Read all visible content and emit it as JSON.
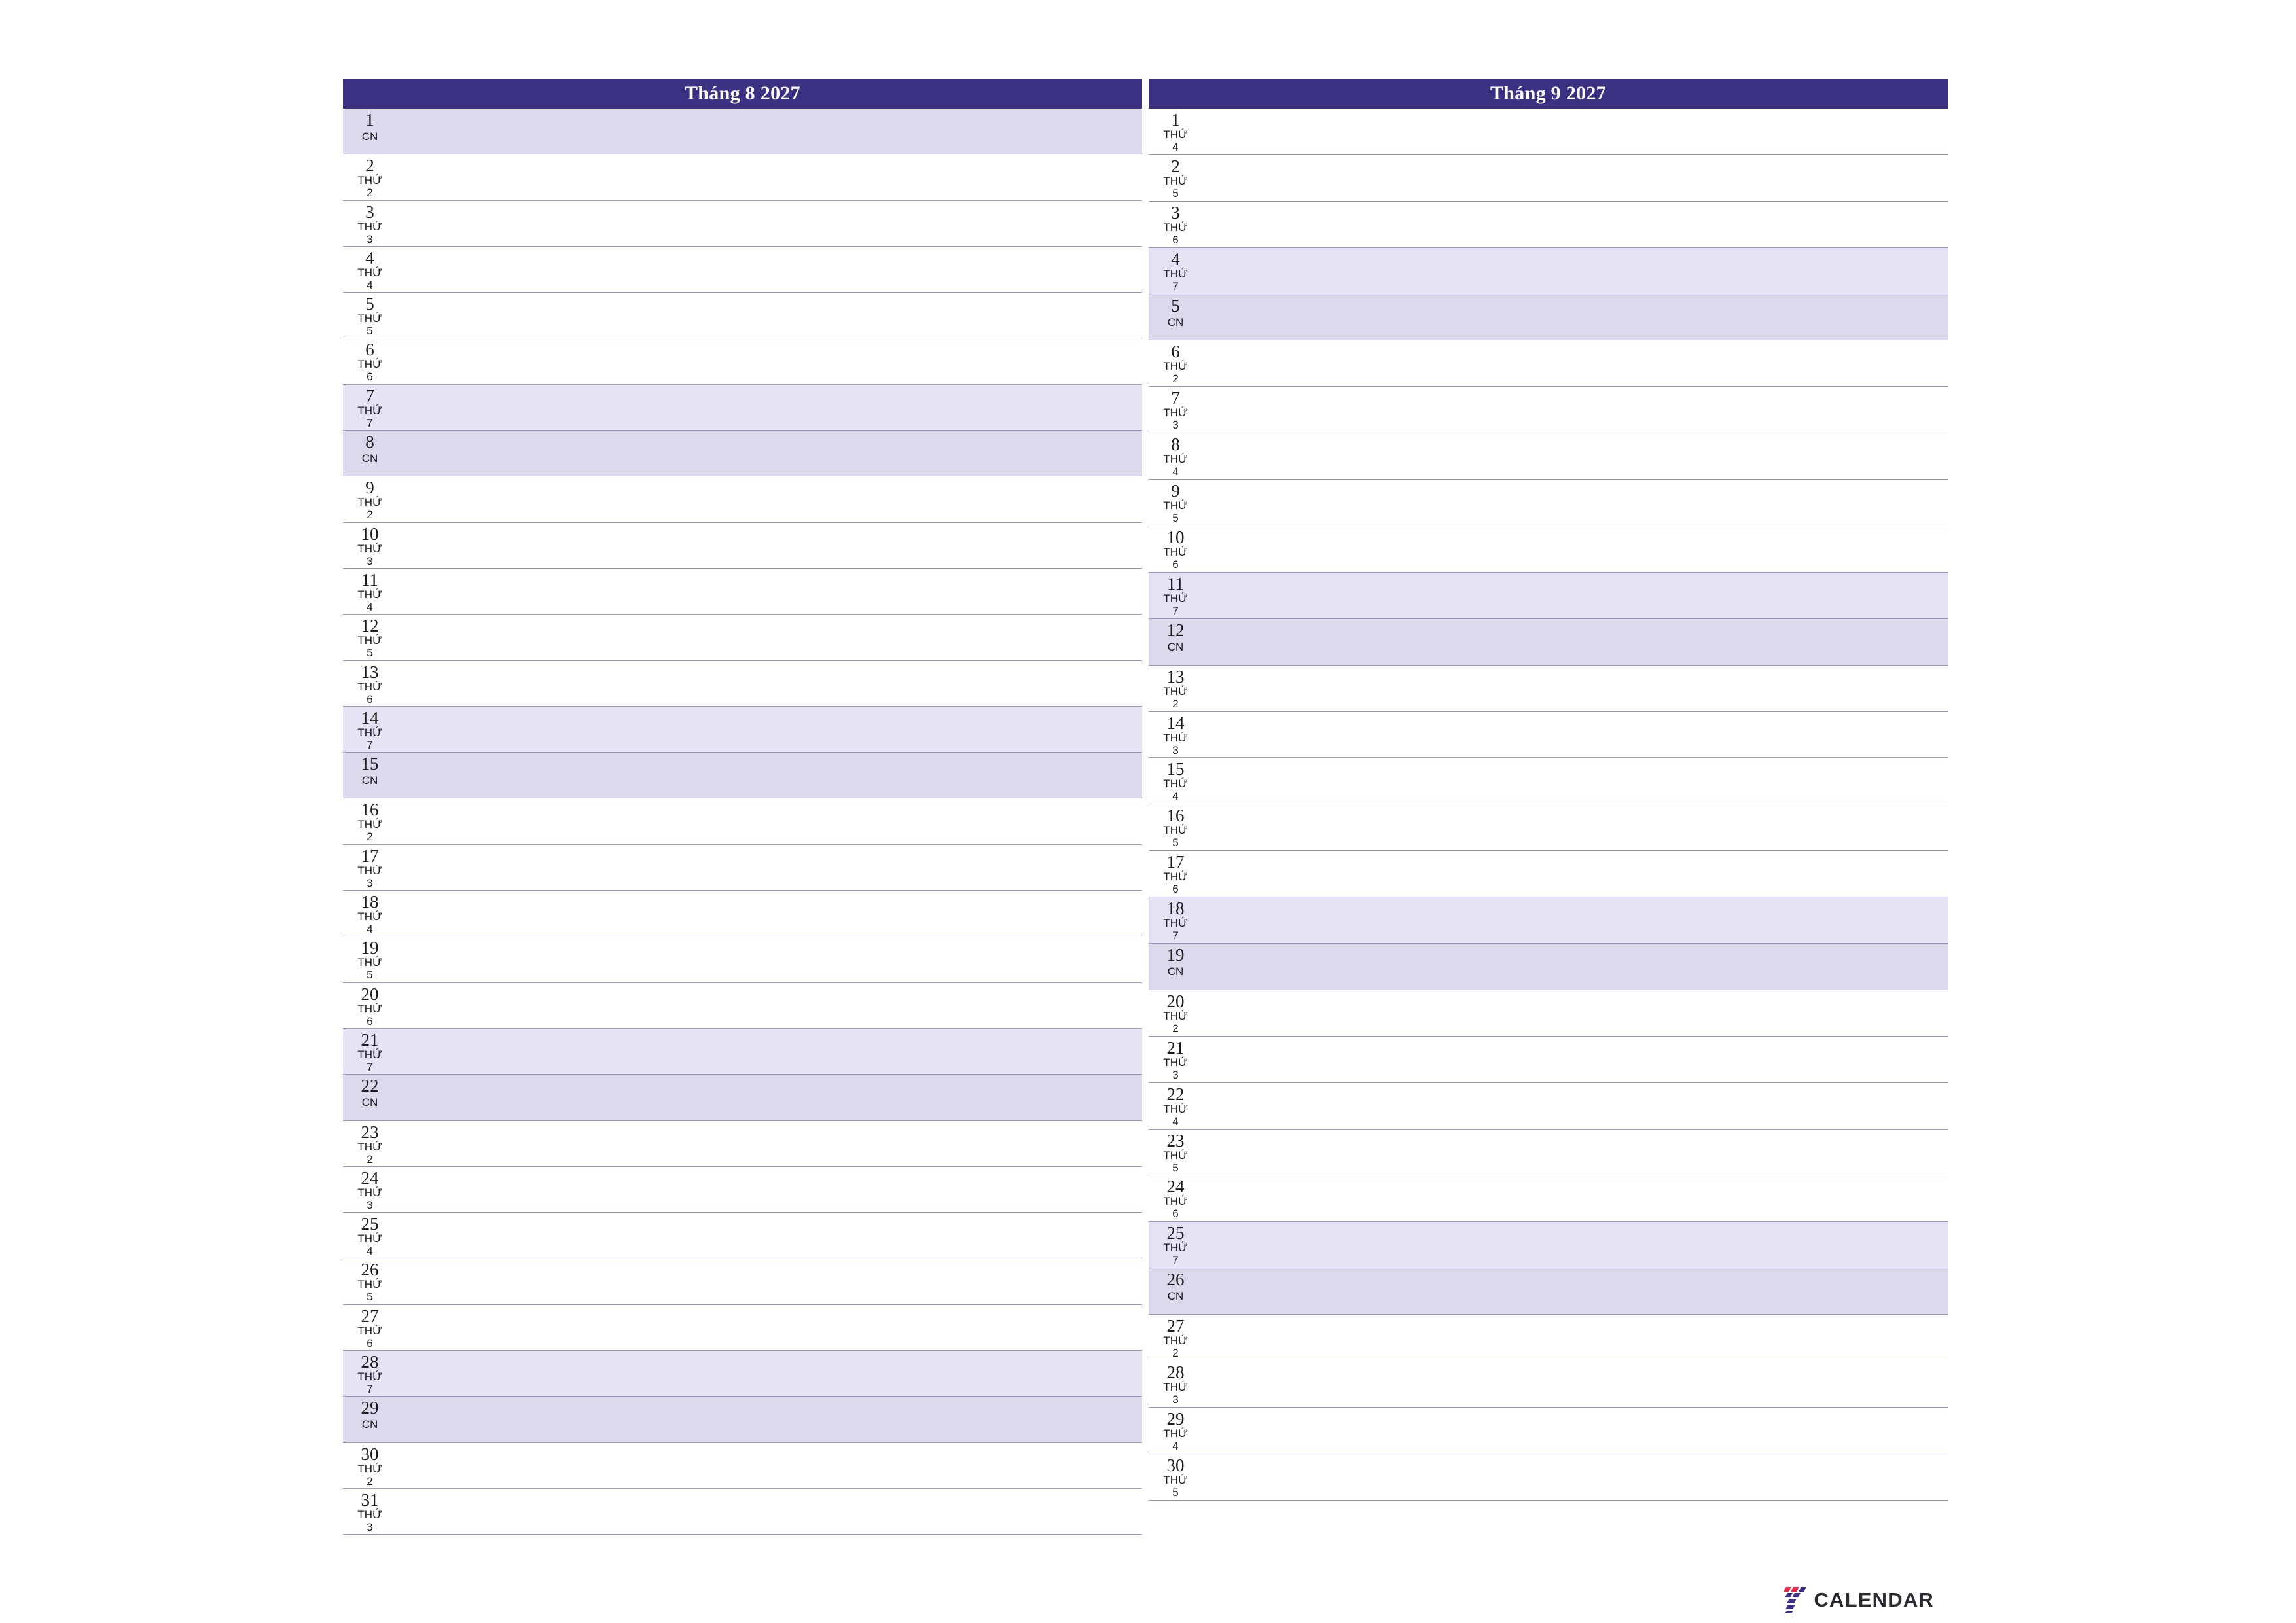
{
  "theme": {
    "header_bg": "#3B3183",
    "header_text": "#FFFFFF",
    "saturday_bg": "#E3E3F4",
    "sunday_bg": "#DCD9EC",
    "row_divider": "#9A95C4",
    "page_bg": "#FFFFFF",
    "text": "#1B1B1B"
  },
  "brand": {
    "name": "7 Calendar",
    "wordmark": "CALENDAR",
    "mark_digit": "7",
    "mark_colors": [
      "#E8294A",
      "#3B3183"
    ]
  },
  "panels": [
    {
      "id": "august",
      "title": "Tháng 8 2027",
      "days": [
        {
          "num": "1",
          "dow_line1": "CN",
          "dow_line2": "",
          "type": "sun"
        },
        {
          "num": "2",
          "dow_line1": "THỨ",
          "dow_line2": "2",
          "type": "weekday"
        },
        {
          "num": "3",
          "dow_line1": "THỨ",
          "dow_line2": "3",
          "type": "weekday"
        },
        {
          "num": "4",
          "dow_line1": "THỨ",
          "dow_line2": "4",
          "type": "weekday"
        },
        {
          "num": "5",
          "dow_line1": "THỨ",
          "dow_line2": "5",
          "type": "weekday"
        },
        {
          "num": "6",
          "dow_line1": "THỨ",
          "dow_line2": "6",
          "type": "weekday"
        },
        {
          "num": "7",
          "dow_line1": "THỨ",
          "dow_line2": "7",
          "type": "sat"
        },
        {
          "num": "8",
          "dow_line1": "CN",
          "dow_line2": "",
          "type": "sun"
        },
        {
          "num": "9",
          "dow_line1": "THỨ",
          "dow_line2": "2",
          "type": "weekday"
        },
        {
          "num": "10",
          "dow_line1": "THỨ",
          "dow_line2": "3",
          "type": "weekday"
        },
        {
          "num": "11",
          "dow_line1": "THỨ",
          "dow_line2": "4",
          "type": "weekday"
        },
        {
          "num": "12",
          "dow_line1": "THỨ",
          "dow_line2": "5",
          "type": "weekday"
        },
        {
          "num": "13",
          "dow_line1": "THỨ",
          "dow_line2": "6",
          "type": "weekday"
        },
        {
          "num": "14",
          "dow_line1": "THỨ",
          "dow_line2": "7",
          "type": "sat"
        },
        {
          "num": "15",
          "dow_line1": "CN",
          "dow_line2": "",
          "type": "sun"
        },
        {
          "num": "16",
          "dow_line1": "THỨ",
          "dow_line2": "2",
          "type": "weekday"
        },
        {
          "num": "17",
          "dow_line1": "THỨ",
          "dow_line2": "3",
          "type": "weekday"
        },
        {
          "num": "18",
          "dow_line1": "THỨ",
          "dow_line2": "4",
          "type": "weekday"
        },
        {
          "num": "19",
          "dow_line1": "THỨ",
          "dow_line2": "5",
          "type": "weekday"
        },
        {
          "num": "20",
          "dow_line1": "THỨ",
          "dow_line2": "6",
          "type": "weekday"
        },
        {
          "num": "21",
          "dow_line1": "THỨ",
          "dow_line2": "7",
          "type": "sat"
        },
        {
          "num": "22",
          "dow_line1": "CN",
          "dow_line2": "",
          "type": "sun"
        },
        {
          "num": "23",
          "dow_line1": "THỨ",
          "dow_line2": "2",
          "type": "weekday"
        },
        {
          "num": "24",
          "dow_line1": "THỨ",
          "dow_line2": "3",
          "type": "weekday"
        },
        {
          "num": "25",
          "dow_line1": "THỨ",
          "dow_line2": "4",
          "type": "weekday"
        },
        {
          "num": "26",
          "dow_line1": "THỨ",
          "dow_line2": "5",
          "type": "weekday"
        },
        {
          "num": "27",
          "dow_line1": "THỨ",
          "dow_line2": "6",
          "type": "weekday"
        },
        {
          "num": "28",
          "dow_line1": "THỨ",
          "dow_line2": "7",
          "type": "sat"
        },
        {
          "num": "29",
          "dow_line1": "CN",
          "dow_line2": "",
          "type": "sun"
        },
        {
          "num": "30",
          "dow_line1": "THỨ",
          "dow_line2": "2",
          "type": "weekday"
        },
        {
          "num": "31",
          "dow_line1": "THỨ",
          "dow_line2": "3",
          "type": "weekday"
        }
      ]
    },
    {
      "id": "september",
      "title": "Tháng 9 2027",
      "days": [
        {
          "num": "1",
          "dow_line1": "THỨ",
          "dow_line2": "4",
          "type": "weekday"
        },
        {
          "num": "2",
          "dow_line1": "THỨ",
          "dow_line2": "5",
          "type": "weekday"
        },
        {
          "num": "3",
          "dow_line1": "THỨ",
          "dow_line2": "6",
          "type": "weekday"
        },
        {
          "num": "4",
          "dow_line1": "THỨ",
          "dow_line2": "7",
          "type": "sat"
        },
        {
          "num": "5",
          "dow_line1": "CN",
          "dow_line2": "",
          "type": "sun"
        },
        {
          "num": "6",
          "dow_line1": "THỨ",
          "dow_line2": "2",
          "type": "weekday"
        },
        {
          "num": "7",
          "dow_line1": "THỨ",
          "dow_line2": "3",
          "type": "weekday"
        },
        {
          "num": "8",
          "dow_line1": "THỨ",
          "dow_line2": "4",
          "type": "weekday"
        },
        {
          "num": "9",
          "dow_line1": "THỨ",
          "dow_line2": "5",
          "type": "weekday"
        },
        {
          "num": "10",
          "dow_line1": "THỨ",
          "dow_line2": "6",
          "type": "weekday"
        },
        {
          "num": "11",
          "dow_line1": "THỨ",
          "dow_line2": "7",
          "type": "sat"
        },
        {
          "num": "12",
          "dow_line1": "CN",
          "dow_line2": "",
          "type": "sun"
        },
        {
          "num": "13",
          "dow_line1": "THỨ",
          "dow_line2": "2",
          "type": "weekday"
        },
        {
          "num": "14",
          "dow_line1": "THỨ",
          "dow_line2": "3",
          "type": "weekday"
        },
        {
          "num": "15",
          "dow_line1": "THỨ",
          "dow_line2": "4",
          "type": "weekday"
        },
        {
          "num": "16",
          "dow_line1": "THỨ",
          "dow_line2": "5",
          "type": "weekday"
        },
        {
          "num": "17",
          "dow_line1": "THỨ",
          "dow_line2": "6",
          "type": "weekday"
        },
        {
          "num": "18",
          "dow_line1": "THỨ",
          "dow_line2": "7",
          "type": "sat"
        },
        {
          "num": "19",
          "dow_line1": "CN",
          "dow_line2": "",
          "type": "sun"
        },
        {
          "num": "20",
          "dow_line1": "THỨ",
          "dow_line2": "2",
          "type": "weekday"
        },
        {
          "num": "21",
          "dow_line1": "THỨ",
          "dow_line2": "3",
          "type": "weekday"
        },
        {
          "num": "22",
          "dow_line1": "THỨ",
          "dow_line2": "4",
          "type": "weekday"
        },
        {
          "num": "23",
          "dow_line1": "THỨ",
          "dow_line2": "5",
          "type": "weekday"
        },
        {
          "num": "24",
          "dow_line1": "THỨ",
          "dow_line2": "6",
          "type": "weekday"
        },
        {
          "num": "25",
          "dow_line1": "THỨ",
          "dow_line2": "7",
          "type": "sat"
        },
        {
          "num": "26",
          "dow_line1": "CN",
          "dow_line2": "",
          "type": "sun"
        },
        {
          "num": "27",
          "dow_line1": "THỨ",
          "dow_line2": "2",
          "type": "weekday"
        },
        {
          "num": "28",
          "dow_line1": "THỨ",
          "dow_line2": "3",
          "type": "weekday"
        },
        {
          "num": "29",
          "dow_line1": "THỨ",
          "dow_line2": "4",
          "type": "weekday"
        },
        {
          "num": "30",
          "dow_line1": "THỨ",
          "dow_line2": "5",
          "type": "weekday"
        }
      ]
    }
  ]
}
